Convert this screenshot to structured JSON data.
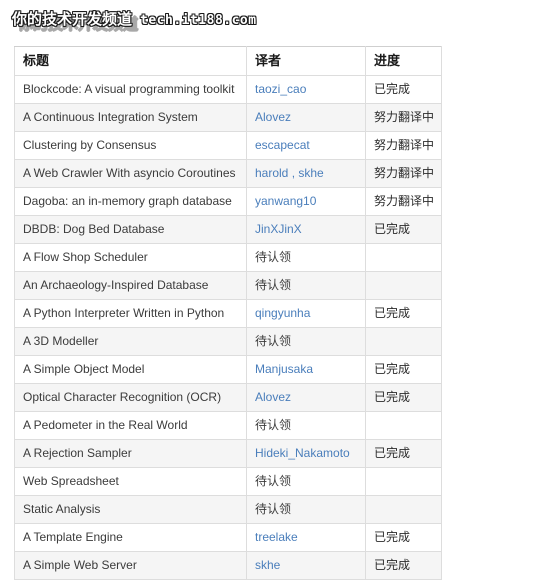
{
  "watermark": {
    "brand_cn": "你的技术开发频道",
    "url": "tech.it188.com",
    "ghost_cn": "你的技术开发频道"
  },
  "table": {
    "columns": [
      {
        "key": "title",
        "label": "标题"
      },
      {
        "key": "translator",
        "label": "译者"
      },
      {
        "key": "progress",
        "label": "进度"
      }
    ],
    "unclaimed_label": "待认领",
    "status_done": "已完成",
    "status_in_progress": "努力翻译中",
    "link_color": "#4a7ebb",
    "shaded_row_color": "#f5f5f5",
    "border_color": "#dddddd",
    "rows": [
      {
        "title": "Blockcode: A visual programming toolkit",
        "translator": "taozi_cao",
        "translator_is_link": true,
        "progress": "已完成"
      },
      {
        "title": "A Continuous Integration System",
        "translator": "Alovez",
        "translator_is_link": true,
        "progress": "努力翻译中"
      },
      {
        "title": "Clustering by Consensus",
        "translator": "escapecat",
        "translator_is_link": true,
        "progress": "努力翻译中"
      },
      {
        "title": "A Web Crawler With asyncio Coroutines",
        "translator": "harold , skhe",
        "translator_is_link": true,
        "progress": "努力翻译中"
      },
      {
        "title": "Dagoba: an in-memory graph database",
        "translator": "yanwang10",
        "translator_is_link": true,
        "progress": "努力翻译中"
      },
      {
        "title": "DBDB: Dog Bed Database",
        "translator": "JinXJinX",
        "translator_is_link": true,
        "progress": "已完成"
      },
      {
        "title": "A Flow Shop Scheduler",
        "translator": "待认领",
        "translator_is_link": false,
        "progress": ""
      },
      {
        "title": "An Archaeology-Inspired Database",
        "translator": "待认领",
        "translator_is_link": false,
        "progress": ""
      },
      {
        "title": "A Python Interpreter Written in Python",
        "translator": "qingyunha",
        "translator_is_link": true,
        "progress": "已完成"
      },
      {
        "title": "A 3D Modeller",
        "translator": "待认领",
        "translator_is_link": false,
        "progress": ""
      },
      {
        "title": "A Simple Object Model",
        "translator": "Manjusaka",
        "translator_is_link": true,
        "progress": "已完成"
      },
      {
        "title": "Optical Character Recognition (OCR)",
        "translator": "Alovez",
        "translator_is_link": true,
        "progress": "已完成"
      },
      {
        "title": "A Pedometer in the Real World",
        "translator": "待认领",
        "translator_is_link": false,
        "progress": ""
      },
      {
        "title": "A Rejection Sampler",
        "translator": "Hideki_Nakamoto",
        "translator_is_link": true,
        "progress": "已完成"
      },
      {
        "title": "Web Spreadsheet",
        "translator": "待认领",
        "translator_is_link": false,
        "progress": ""
      },
      {
        "title": "Static Analysis",
        "translator": "待认领",
        "translator_is_link": false,
        "progress": ""
      },
      {
        "title": "A Template Engine",
        "translator": "treelake",
        "translator_is_link": true,
        "progress": "已完成"
      },
      {
        "title": "A Simple Web Server",
        "translator": "skhe",
        "translator_is_link": true,
        "progress": "已完成"
      }
    ]
  }
}
